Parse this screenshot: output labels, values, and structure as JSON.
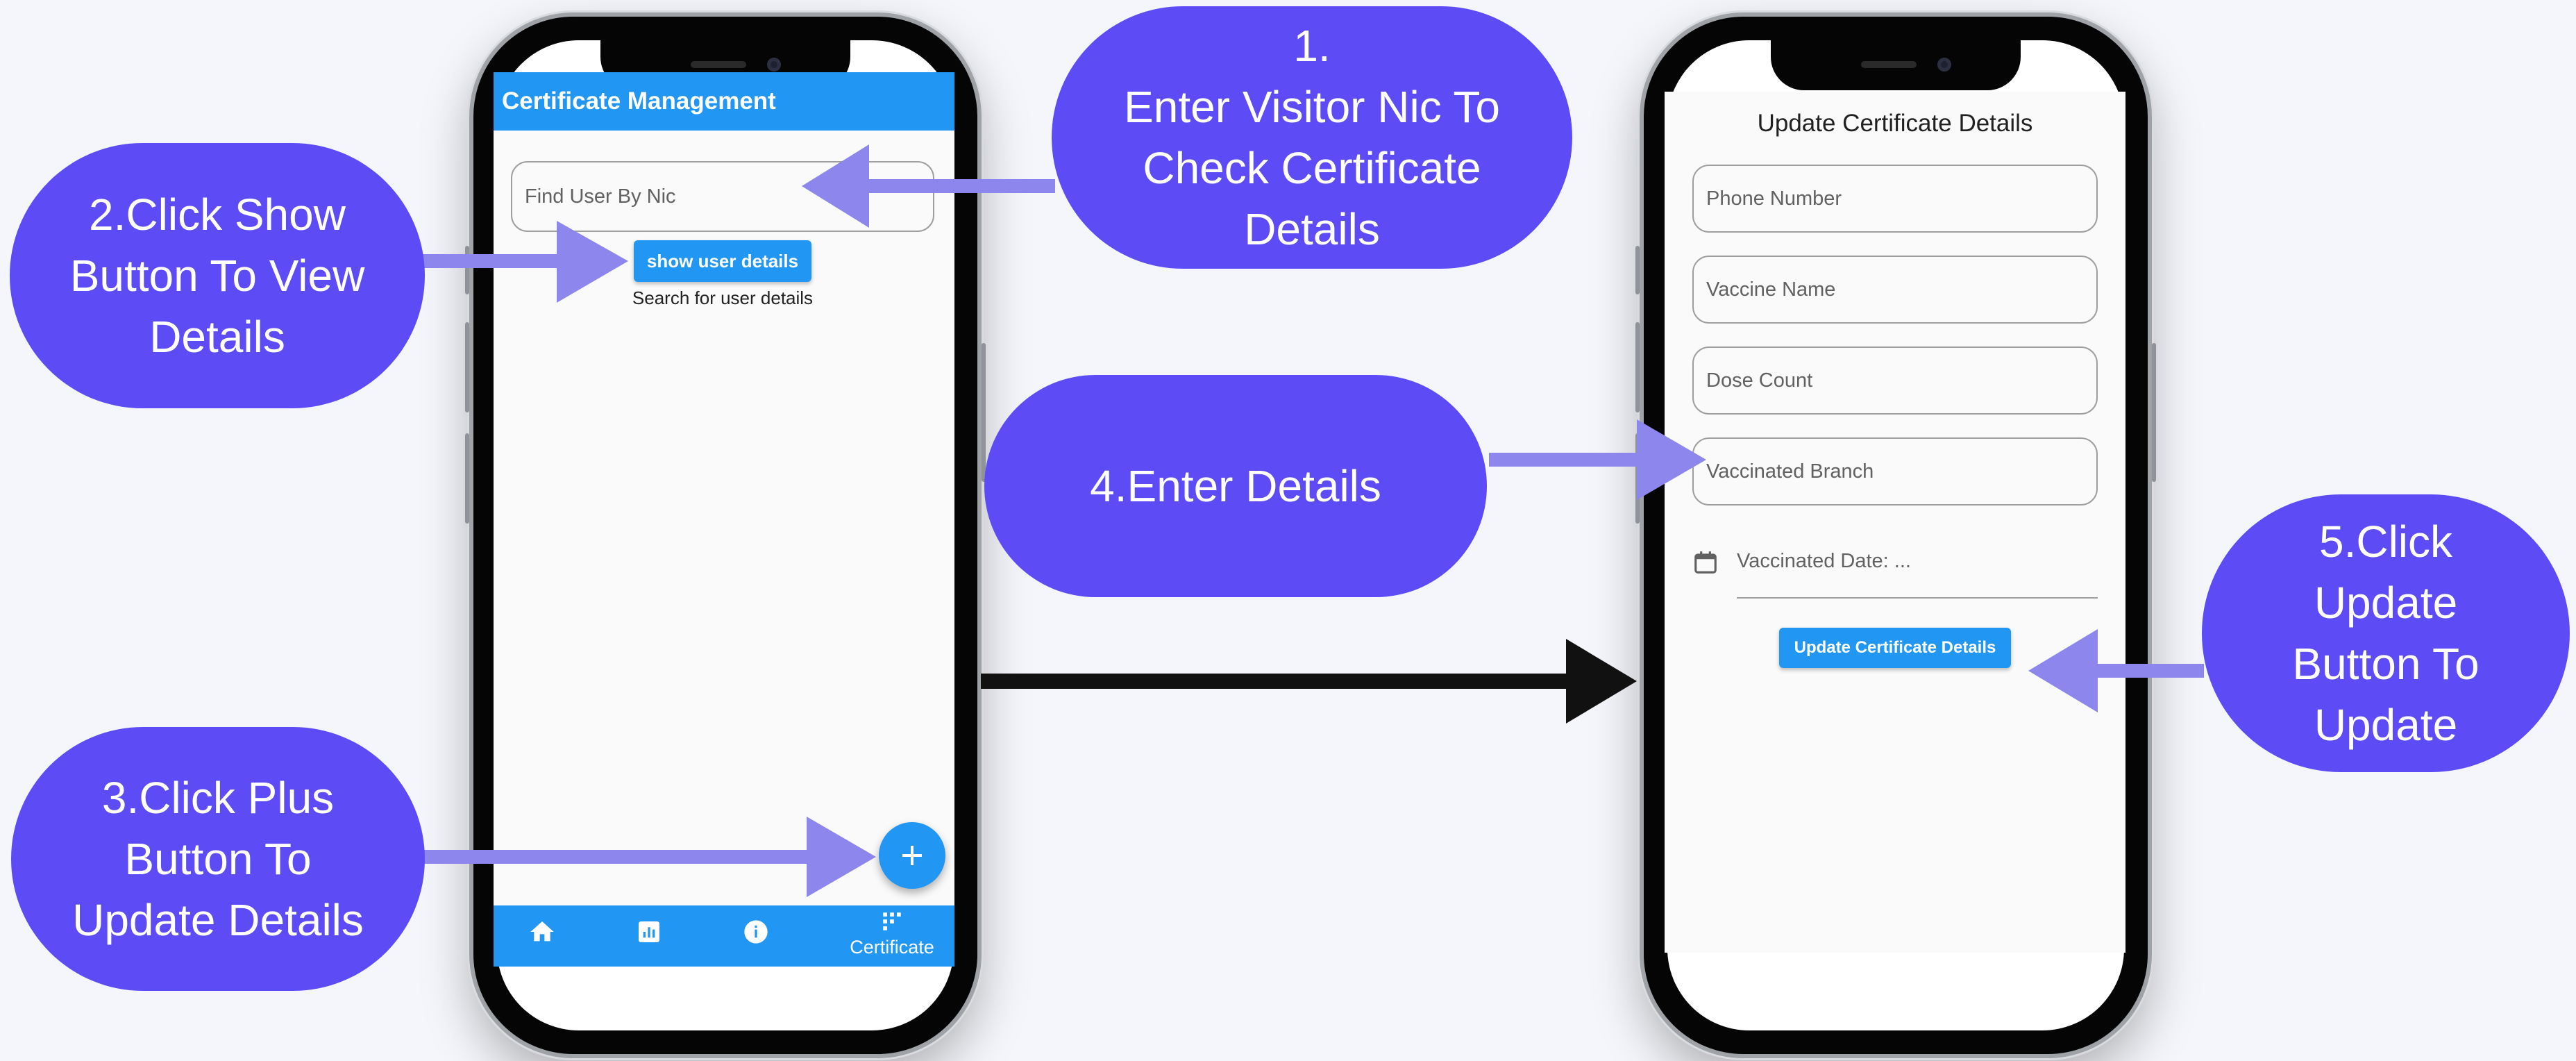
{
  "left_screen": {
    "appbar_title": "Certificate Management",
    "search": {
      "placeholder": "Find User By Nic"
    },
    "show_button_label": "show user details",
    "search_hint": "Search for user details",
    "fab_icon": "add-icon",
    "bottom_nav": {
      "items": [
        {
          "icon": "home-icon"
        },
        {
          "icon": "chart-icon"
        },
        {
          "icon": "info-icon"
        },
        {
          "icon": "grid-icon",
          "label": "Certificate"
        }
      ]
    }
  },
  "right_screen": {
    "title": "Update Certificate Details",
    "fields": [
      {
        "placeholder": "Phone Number"
      },
      {
        "placeholder": "Vaccine Name"
      },
      {
        "placeholder": "Dose Count"
      },
      {
        "placeholder": "Vaccinated Branch"
      }
    ],
    "date_field": {
      "icon": "calendar-icon",
      "label": "Vaccinated Date: ..."
    },
    "update_button_label": "Update Certificate Details"
  },
  "callouts": {
    "step1": "1.\nEnter Visitor Nic To\nCheck Certificate\nDetails",
    "step2": "2.Click Show\nButton To View\nDetails",
    "step3": "3.Click Plus\nButton To\nUpdate Details",
    "step4": "4.Enter Details",
    "step5": "5.Click\nUpdate\nButton To\nUpdate"
  },
  "colors": {
    "bubble": "#5d4cf5",
    "arrow": "#8d86ec",
    "app_primary": "#2196f3",
    "flow_arrow": "#111111"
  }
}
